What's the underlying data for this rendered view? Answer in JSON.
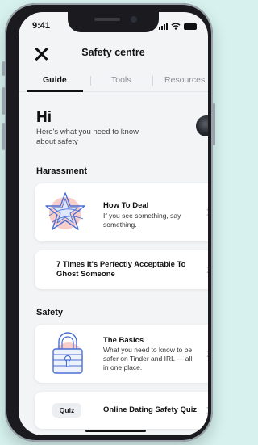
{
  "status": {
    "time": "9:41"
  },
  "header": {
    "title": "Safety centre",
    "close_icon": "close-icon"
  },
  "tabs": [
    {
      "label": "Guide",
      "active": true
    },
    {
      "label": "Tools",
      "active": false
    },
    {
      "label": "Resources",
      "active": false
    }
  ],
  "greeting": {
    "title": "Hi",
    "subtitle": "Here's what you need to know about safety"
  },
  "sections": {
    "harassment": {
      "title": "Harassment",
      "card1": {
        "title": "How To Deal",
        "description": "If you see something, say something.",
        "icon": "star-badge-icon"
      },
      "card2": {
        "title": "7 Times It's Perfectly Acceptable To Ghost Someone"
      }
    },
    "safety": {
      "title": "Safety",
      "card1": {
        "title": "The Basics",
        "description": "What you need to know to be safer on Tinder and IRL — all in one place.",
        "icon": "padlock-icon"
      },
      "card2": {
        "badge": "Quiz",
        "title": "Online Dating Safety Quiz"
      }
    }
  },
  "colors": {
    "background": "#d6f1ee",
    "accent_blue": "#4a6fd6",
    "accent_pink": "#f6c9c3"
  }
}
